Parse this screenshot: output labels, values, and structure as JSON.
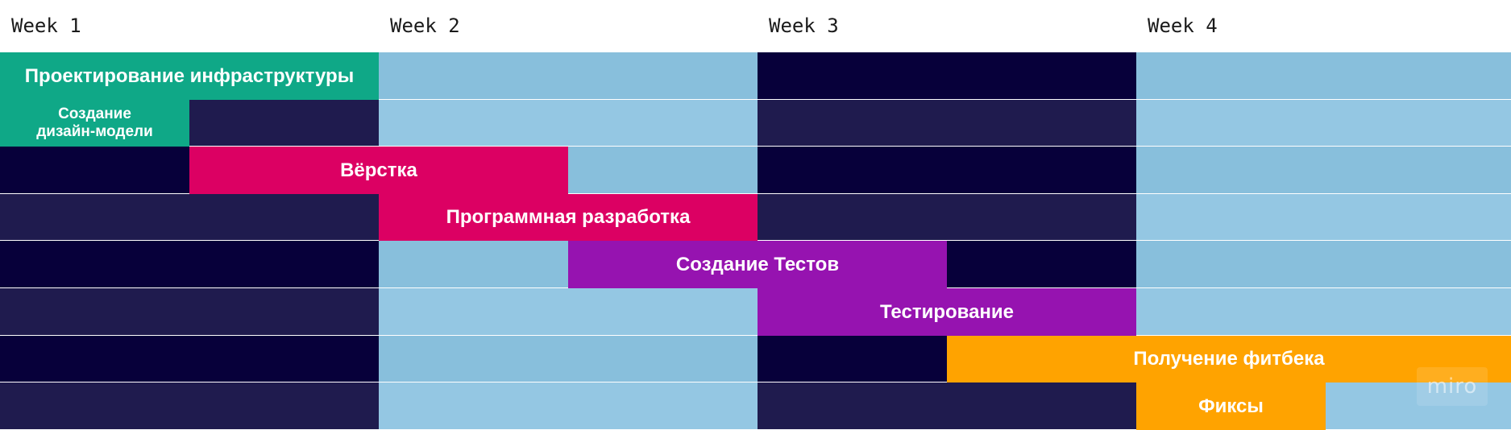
{
  "weeks": [
    "Week 1",
    "Week 2",
    "Week 3",
    "Week 4"
  ],
  "colors": {
    "dark_odd": "#07003a",
    "dark_even": "#1f1b4e",
    "light_odd": "#88bfdc",
    "light_even": "#94c7e3",
    "green": "#0fa887",
    "pink": "#dc0063",
    "purple": "#9613b0",
    "orange": "#ffa300"
  },
  "week_shading": [
    "dark",
    "light",
    "dark",
    "light"
  ],
  "tasks": [
    {
      "label": "Проектирование инфраструктуры",
      "row": 0,
      "start": 0,
      "end": 1,
      "color": "green"
    },
    {
      "label": "Создание\nдизайн-модели",
      "row": 1,
      "start": 0,
      "end": 0.5,
      "color": "green"
    },
    {
      "label": "Вёрстка",
      "row": 2,
      "start": 0.5,
      "end": 1.5,
      "color": "pink"
    },
    {
      "label": "Программная разработка",
      "row": 3,
      "start": 1,
      "end": 2,
      "color": "pink"
    },
    {
      "label": "Создание Тестов",
      "row": 4,
      "start": 1.5,
      "end": 2.5,
      "color": "purple"
    },
    {
      "label": "Тестирование",
      "row": 5,
      "start": 2,
      "end": 3,
      "color": "purple"
    },
    {
      "label": "Получение фитбека",
      "row": 6,
      "start": 2.5,
      "end": 4,
      "color": "orange"
    },
    {
      "label": "Фиксы",
      "row": 7,
      "start": 3,
      "end": 3.5,
      "color": "orange"
    }
  ],
  "rows": 8,
  "watermark": "miro"
}
